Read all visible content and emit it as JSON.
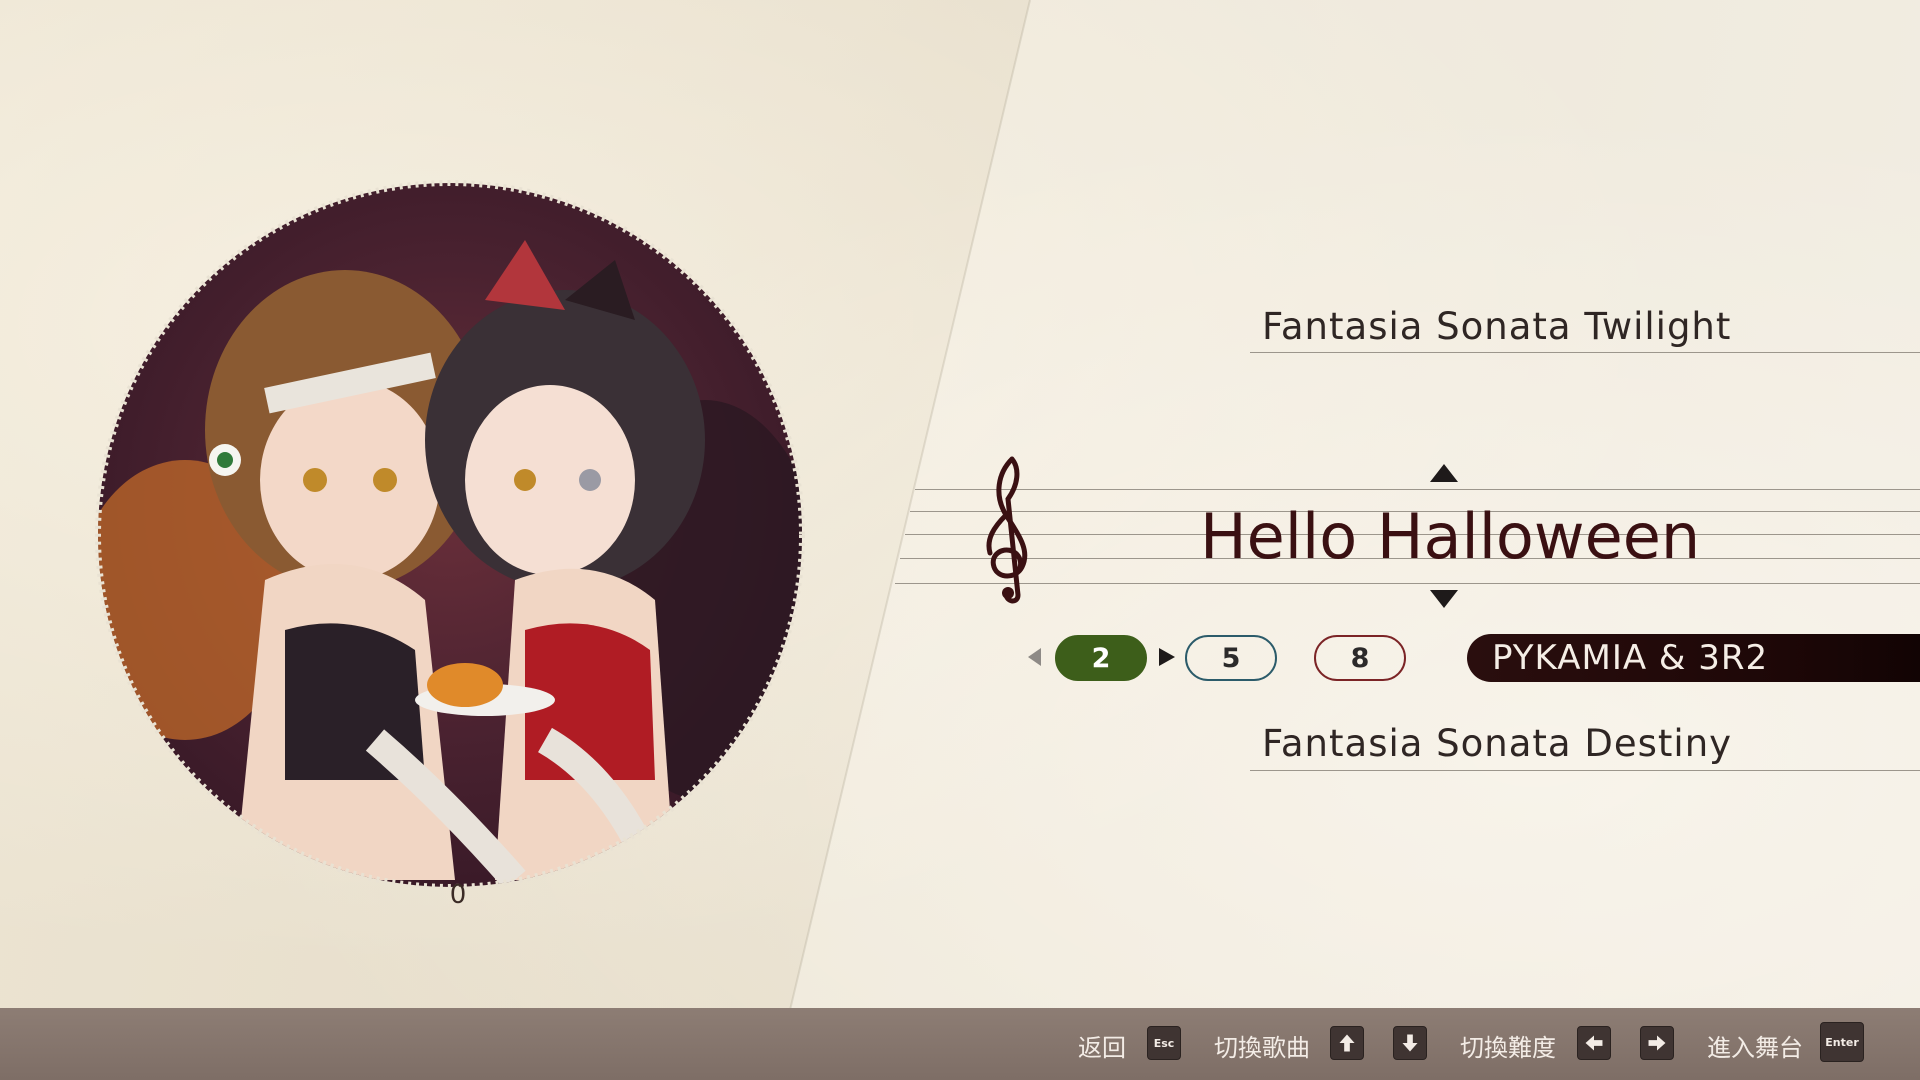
{
  "songs": {
    "previous": "Fantasia Sonata Twilight",
    "current": "Hello Halloween",
    "next": "Fantasia Sonata Destiny"
  },
  "cover": {
    "marker": "0"
  },
  "difficulties": [
    {
      "level": "2",
      "color": "#3d5e1a",
      "selected": true
    },
    {
      "level": "5",
      "color": "#2b5b6a",
      "selected": false
    },
    {
      "level": "8",
      "color": "#7b2426",
      "selected": false
    }
  ],
  "artist": "PYKAMIA & 3R2",
  "footer": {
    "back_label": "返回",
    "back_key": "Esc",
    "switch_song_label": "切換歌曲",
    "switch_difficulty_label": "切換難度",
    "enter_stage_label": "進入舞台",
    "enter_key": "Enter"
  },
  "icons": {
    "clef": "treble-clef-icon",
    "song_up": "triangle-up-icon",
    "song_down": "triangle-down-icon",
    "diff_left": "triangle-left-icon",
    "diff_right": "triangle-right-icon",
    "key_up": "arrow-up-key-icon",
    "key_down": "arrow-down-key-icon",
    "key_left": "arrow-left-key-icon",
    "key_right": "arrow-right-key-icon"
  }
}
